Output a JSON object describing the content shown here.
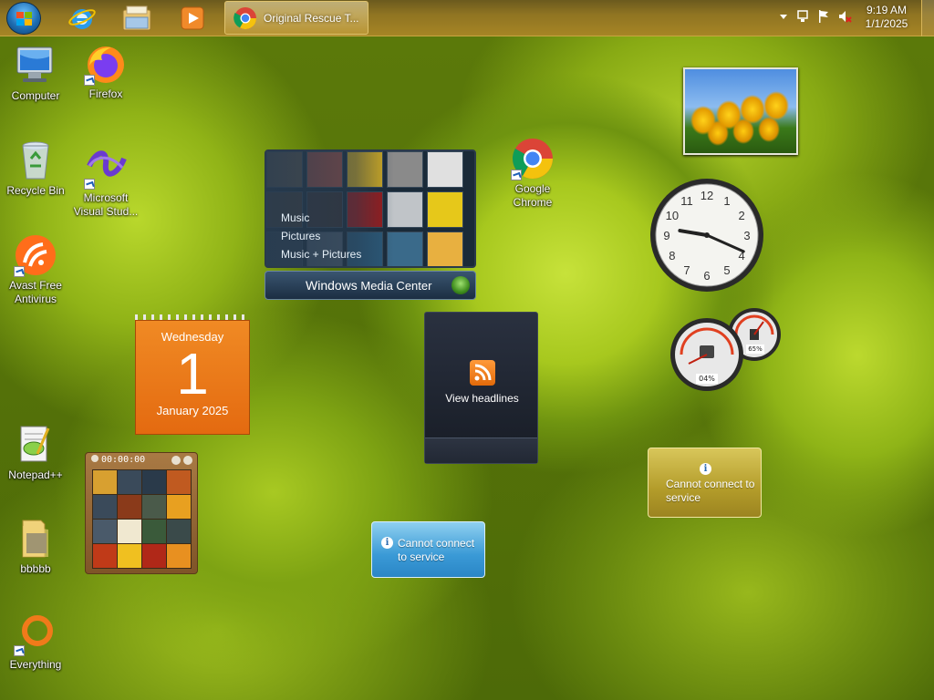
{
  "taskbar": {
    "pinned": [
      {
        "name": "internet-explorer-icon"
      },
      {
        "name": "windows-explorer-icon"
      },
      {
        "name": "media-player-icon"
      }
    ],
    "active_task": {
      "label": "Original Rescue T...",
      "icon": "chrome-icon"
    },
    "tray_icons": [
      "show-hidden-icons-arrow",
      "network-icon",
      "action-center-flag-icon",
      "volume-muted-icon"
    ],
    "clock": {
      "time": "9:19 AM",
      "date": "1/1/2025"
    }
  },
  "desktop_icons": [
    {
      "key": "computer",
      "label": "Computer",
      "icon": "computer-icon"
    },
    {
      "key": "firefox",
      "label": "Firefox",
      "icon": "firefox-icon"
    },
    {
      "key": "recycle_bin",
      "label": "Recycle Bin",
      "icon": "recycle-bin-icon"
    },
    {
      "key": "ms_visual_studio",
      "label": "Microsoft Visual Stud...",
      "icon": "visual-studio-icon"
    },
    {
      "key": "google_chrome",
      "label": "Google Chrome",
      "icon": "chrome-icon"
    },
    {
      "key": "avast",
      "label": "Avast Free Antivirus",
      "icon": "avast-icon"
    },
    {
      "key": "notepadpp",
      "label": "Notepad++",
      "icon": "notepadpp-icon"
    },
    {
      "key": "bbbbb",
      "label": "bbbbb",
      "icon": "folder-icon"
    },
    {
      "key": "everything",
      "label": "Everything",
      "icon": "everything-icon"
    }
  ],
  "gadgets": {
    "media_center": {
      "menu": [
        "Music",
        "Pictures",
        "Music + Pictures"
      ],
      "title_windows": "Windows",
      "title_rest": " Media Center"
    },
    "calendar": {
      "weekday": "Wednesday",
      "day": "1",
      "month_year": "January 2025"
    },
    "puzzle": {
      "timer": "00:00:00"
    },
    "feed_headlines": {
      "label": "View headlines"
    },
    "clock": {
      "hour": 9,
      "minute": 19
    },
    "cpu_meter": {
      "cpu": "04%",
      "memory": "65%"
    },
    "weather_1": {
      "message": "Cannot connect to service"
    },
    "weather_2": {
      "message": "Cannot connect to service"
    }
  },
  "colors": {
    "taskbar": "#8f7422",
    "calendar": "#e46a10",
    "wallpaper_green": "#a7c81e"
  }
}
